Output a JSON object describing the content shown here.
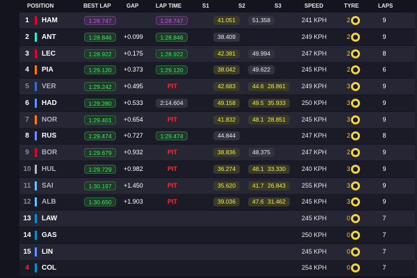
{
  "header": {
    "position": "POSITION",
    "best_lap": "BEST LAP",
    "gap": "GAP",
    "lap_time": "LAP TIME",
    "s1": "S1",
    "s2": "S2",
    "s3": "S3",
    "speed": "SPEED",
    "tyre": "TYRE",
    "laps": "LAPS"
  },
  "colors": {
    "purple": "#c158d6",
    "green": "#3ce66a",
    "yellow": "#f0e84a",
    "pit": "#ff2a2a",
    "tyre_medium": "#f3d33a"
  },
  "rows": [
    {
      "pos": "1",
      "pos_dim": false,
      "team_color": "#e8002d",
      "code": "HAM",
      "best_lap": "1:28.747",
      "best_style": "purple",
      "gap": "",
      "lap_time": "1:28.747",
      "lap_style": "purple",
      "pit": false,
      "s1": "41.051",
      "s1_style": "yellow",
      "s2": "51.358",
      "s2_style": "white",
      "s3": "",
      "s3_style": "",
      "speed": "241 KPH",
      "tyre_laps": "2",
      "tyre_laps_color": "#f3d33a",
      "tyre": "medium-tyre-icon",
      "laps": "9"
    },
    {
      "pos": "2",
      "pos_dim": false,
      "team_color": "#27f4d2",
      "code": "ANT",
      "best_lap": "1:28.846",
      "best_style": "green",
      "gap": "+0.099",
      "lap_time": "1:28.846",
      "lap_style": "green",
      "pit": false,
      "s1": "38.409",
      "s1_style": "white",
      "s2": "",
      "s2_style": "",
      "s3": "",
      "s3_style": "",
      "speed": "249 KPH",
      "tyre_laps": "2",
      "tyre_laps_color": "#f3d33a",
      "tyre": "medium-tyre-icon",
      "laps": "9"
    },
    {
      "pos": "3",
      "pos_dim": false,
      "team_color": "#e8002d",
      "code": "LEC",
      "best_lap": "1:28.922",
      "best_style": "green",
      "gap": "+0.175",
      "lap_time": "1:28.922",
      "lap_style": "green",
      "pit": false,
      "s1": "42.381",
      "s1_style": "yellow",
      "s2": "49.994",
      "s2_style": "white",
      "s3": "",
      "s3_style": "",
      "speed": "247 KPH",
      "tyre_laps": "2",
      "tyre_laps_color": "#f3d33a",
      "tyre": "medium-tyre-icon",
      "laps": "8"
    },
    {
      "pos": "4",
      "pos_dim": false,
      "team_color": "#ff8000",
      "code": "PIA",
      "best_lap": "1:29.120",
      "best_style": "green",
      "gap": "+0.373",
      "lap_time": "1:29.120",
      "lap_style": "green",
      "pit": false,
      "s1": "38.042",
      "s1_style": "yellow",
      "s2": "49.622",
      "s2_style": "white",
      "s3": "",
      "s3_style": "",
      "speed": "245 KPH",
      "tyre_laps": "2",
      "tyre_laps_color": "#f3d33a",
      "tyre": "medium-tyre-icon",
      "laps": "6"
    },
    {
      "pos": "5",
      "pos_dim": true,
      "team_color": "#3671c6",
      "code": "VER",
      "best_lap": "1:29.242",
      "best_style": "green",
      "gap": "+0.495",
      "lap_time": "",
      "lap_style": "",
      "pit": true,
      "pit_label": "PIT",
      "s1": "42.683",
      "s1_style": "yellow",
      "s2": "44.676",
      "s2_style": "yellow",
      "s3": "28.861",
      "s3_style": "yellow",
      "speed": "249 KPH",
      "tyre_laps": "3",
      "tyre_laps_color": "#f3d33a",
      "tyre": "medium-tyre-icon",
      "laps": "9"
    },
    {
      "pos": "6",
      "pos_dim": false,
      "team_color": "#6692ff",
      "code": "HAD",
      "best_lap": "1:29.280",
      "best_style": "green",
      "gap": "+0.533",
      "lap_time": "2:14.604",
      "lap_style": "white",
      "pit": false,
      "s1": "49.158",
      "s1_style": "yellow",
      "s2": "49.513",
      "s2_style": "yellow",
      "s3": "35.933",
      "s3_style": "yellow",
      "speed": "250 KPH",
      "tyre_laps": "3",
      "tyre_laps_color": "#f3d33a",
      "tyre": "medium-tyre-icon",
      "laps": "9"
    },
    {
      "pos": "7",
      "pos_dim": true,
      "team_color": "#ff8000",
      "code": "NOR",
      "best_lap": "1:29.401",
      "best_style": "green",
      "gap": "+0.654",
      "lap_time": "",
      "lap_style": "",
      "pit": true,
      "pit_label": "PIT",
      "s1": "41.832",
      "s1_style": "yellow",
      "s2": "48.129",
      "s2_style": "yellow",
      "s3": "28.851",
      "s3_style": "yellow",
      "speed": "245 KPH",
      "tyre_laps": "3",
      "tyre_laps_color": "#f3d33a",
      "tyre": "medium-tyre-icon",
      "laps": "9"
    },
    {
      "pos": "8",
      "pos_dim": false,
      "team_color": "#6692ff",
      "code": "RUS",
      "best_lap": "1:29.474",
      "best_style": "green",
      "gap": "+0.727",
      "lap_time": "1:29.474",
      "lap_style": "green",
      "pit": false,
      "s1": "44.844",
      "s1_style": "white",
      "s2": "",
      "s2_style": "",
      "s3": "",
      "s3_style": "",
      "speed": "247 KPH",
      "tyre_laps": "2",
      "tyre_laps_color": "#f3d33a",
      "tyre": "medium-tyre-icon",
      "laps": "8"
    },
    {
      "pos": "9",
      "pos_dim": true,
      "team_color": "#e8002d",
      "code": "BOR",
      "best_lap": "1:29.679",
      "best_style": "green",
      "gap": "+0.932",
      "lap_time": "",
      "lap_style": "",
      "pit": true,
      "pit_label": "PIT",
      "s1": "38.836",
      "s1_style": "yellow",
      "s2": "48.375",
      "s2_style": "white",
      "s3": "",
      "s3_style": "",
      "speed": "247 KPH",
      "tyre_laps": "2",
      "tyre_laps_color": "#f3d33a",
      "tyre": "medium-tyre-icon",
      "laps": "9"
    },
    {
      "pos": "10",
      "pos_dim": true,
      "team_color": "#b6babd",
      "code": "HUL",
      "best_lap": "1:29.729",
      "best_style": "green",
      "gap": "+0.982",
      "lap_time": "",
      "lap_style": "",
      "pit": true,
      "pit_label": "PIT",
      "s1": "36.274",
      "s1_style": "yellow",
      "s2": "48.195",
      "s2_style": "yellow",
      "s3": "33.330",
      "s3_style": "yellow",
      "speed": "240 KPH",
      "tyre_laps": "3",
      "tyre_laps_color": "#f3d33a",
      "tyre": "medium-tyre-icon",
      "laps": "9"
    },
    {
      "pos": "11",
      "pos_dim": true,
      "team_color": "#64c4ff",
      "code": "SAI",
      "best_lap": "1:30.197",
      "best_style": "green",
      "gap": "+1.450",
      "lap_time": "",
      "lap_style": "",
      "pit": true,
      "pit_label": "PIT",
      "s1": "35.620",
      "s1_style": "yellow",
      "s2": "41.799",
      "s2_style": "yellow",
      "s3": "26.843",
      "s3_style": "yellow",
      "speed": "255 KPH",
      "tyre_laps": "3",
      "tyre_laps_color": "#f3d33a",
      "tyre": "medium-tyre-icon",
      "laps": "9"
    },
    {
      "pos": "12",
      "pos_dim": true,
      "team_color": "#64c4ff",
      "code": "ALB",
      "best_lap": "1:30.650",
      "best_style": "green",
      "gap": "+1.903",
      "lap_time": "",
      "lap_style": "",
      "pit": true,
      "pit_label": "PIT",
      "s1": "39.036",
      "s1_style": "yellow",
      "s2": "47.665",
      "s2_style": "yellow",
      "s3": "31.462",
      "s3_style": "yellow",
      "speed": "245 KPH",
      "tyre_laps": "3",
      "tyre_laps_color": "#f3d33a",
      "tyre": "medium-tyre-icon",
      "laps": "9"
    },
    {
      "pos": "13",
      "pos_dim": false,
      "team_color": "#0093cc",
      "code": "LAW",
      "best_lap": "",
      "best_style": "",
      "gap": "",
      "lap_time": "",
      "lap_style": "",
      "pit": false,
      "s1": "",
      "s1_style": "",
      "s2": "",
      "s2_style": "",
      "s3": "",
      "s3_style": "",
      "speed": "245 KPH",
      "tyre_laps": "0",
      "tyre_laps_color": "#f3d33a",
      "tyre": "medium-tyre-icon",
      "laps": "7"
    },
    {
      "pos": "14",
      "pos_dim": false,
      "team_color": "#0093cc",
      "code": "GAS",
      "best_lap": "",
      "best_style": "",
      "gap": "",
      "lap_time": "",
      "lap_style": "",
      "pit": false,
      "s1": "",
      "s1_style": "",
      "s2": "",
      "s2_style": "",
      "s3": "",
      "s3_style": "",
      "speed": "250 KPH",
      "tyre_laps": "0",
      "tyre_laps_color": "#f3d33a",
      "tyre": "medium-tyre-icon",
      "laps": "7"
    },
    {
      "pos": "15",
      "pos_dim": false,
      "team_color": "#6692ff",
      "code": "LIN",
      "best_lap": "",
      "best_style": "",
      "gap": "",
      "lap_time": "",
      "lap_style": "",
      "pit": false,
      "s1": "",
      "s1_style": "",
      "s2": "",
      "s2_style": "",
      "s3": "",
      "s3_style": "",
      "speed": "245 KPH",
      "tyre_laps": "0",
      "tyre_laps_color": "#f3d33a",
      "tyre": "medium-tyre-icon",
      "laps": "7"
    },
    {
      "pos": "4",
      "pos_dim": false,
      "pos_color": "#ff2a2a",
      "team_color": "#0093cc",
      "code": "COL",
      "best_lap": "",
      "best_style": "",
      "gap": "",
      "lap_time": "",
      "lap_style": "",
      "pit": false,
      "s1": "",
      "s1_style": "",
      "s2": "",
      "s2_style": "",
      "s3": "",
      "s3_style": "",
      "speed": "254 KPH",
      "tyre_laps": "0",
      "tyre_laps_color": "#f3d33a",
      "tyre": "medium-tyre-icon",
      "laps": "7"
    }
  ]
}
